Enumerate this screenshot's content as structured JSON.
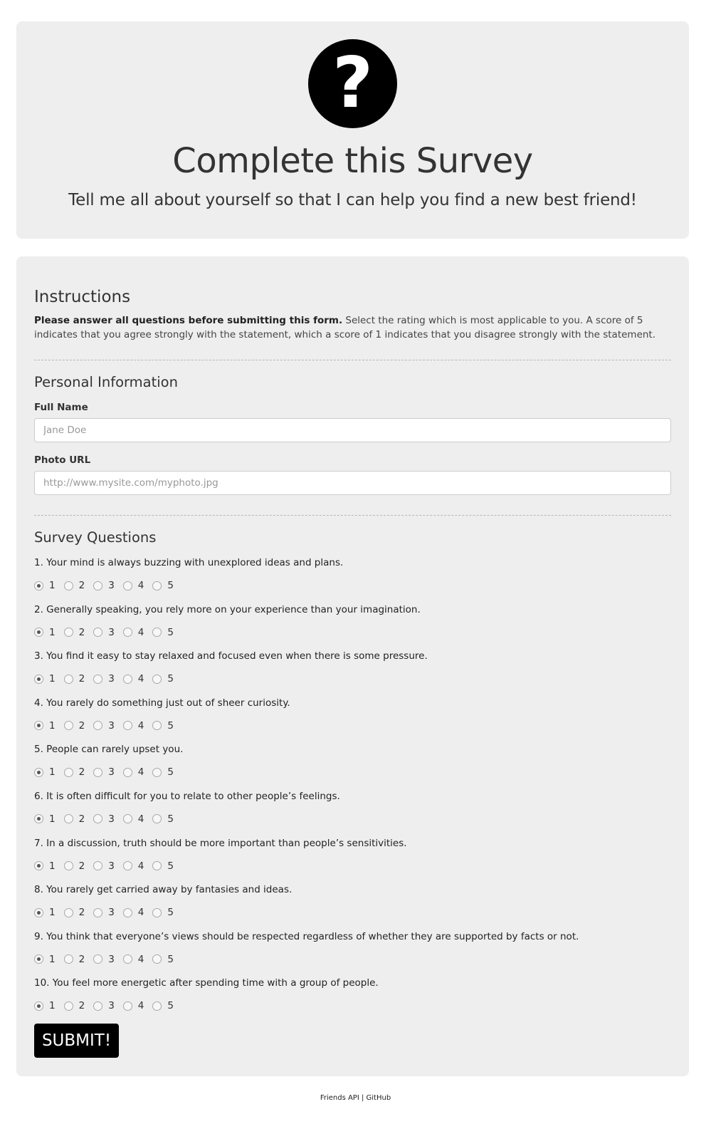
{
  "hero": {
    "logo_glyph": "?",
    "title": "Complete this Survey",
    "subtitle": "Tell me all about yourself so that I can help you find a new best friend!"
  },
  "instructions": {
    "heading": "Instructions",
    "bold_text": "Please answer all questions before submitting this form.",
    "body_text": " Select the rating which is most applicable to you. A score of 5 indicates that you agree strongly with the statement, which a score of 1 indicates that you disagree strongly with the statement."
  },
  "personal": {
    "heading": "Personal Information",
    "name_label": "Full Name",
    "name_placeholder": "Jane Doe",
    "name_value": "",
    "photo_label": "Photo URL",
    "photo_placeholder": "http://www.mysite.com/myphoto.jpg",
    "photo_value": ""
  },
  "survey": {
    "heading": "Survey Questions",
    "options": [
      "1",
      "2",
      "3",
      "4",
      "5"
    ],
    "questions": [
      {
        "text": "1. Your mind is always buzzing with unexplored ideas and plans.",
        "selected": "1"
      },
      {
        "text": "2. Generally speaking, you rely more on your experience than your imagination.",
        "selected": "1"
      },
      {
        "text": "3. You find it easy to stay relaxed and focused even when there is some pressure.",
        "selected": "1"
      },
      {
        "text": "4. You rarely do something just out of sheer curiosity.",
        "selected": "1"
      },
      {
        "text": "5. People can rarely upset you.",
        "selected": "1"
      },
      {
        "text": "6. It is often difficult for you to relate to other people’s feelings.",
        "selected": "1"
      },
      {
        "text": "7. In a discussion, truth should be more important than people’s sensitivities.",
        "selected": "1"
      },
      {
        "text": "8. You rarely get carried away by fantasies and ideas.",
        "selected": "1"
      },
      {
        "text": "9. You think that everyone’s views should be respected regardless of whether they are supported by facts or not.",
        "selected": "1"
      },
      {
        "text": "10. You feel more energetic after spending time with a group of people.",
        "selected": "1"
      }
    ],
    "submit_label": "SUBMIT!"
  },
  "footer": {
    "api_link": "Friends API",
    "separator": " | ",
    "github_link": "GitHub"
  },
  "colors": {
    "panel_bg": "#eeeeee",
    "button_bg": "#000000",
    "button_text": "#ffffff"
  }
}
